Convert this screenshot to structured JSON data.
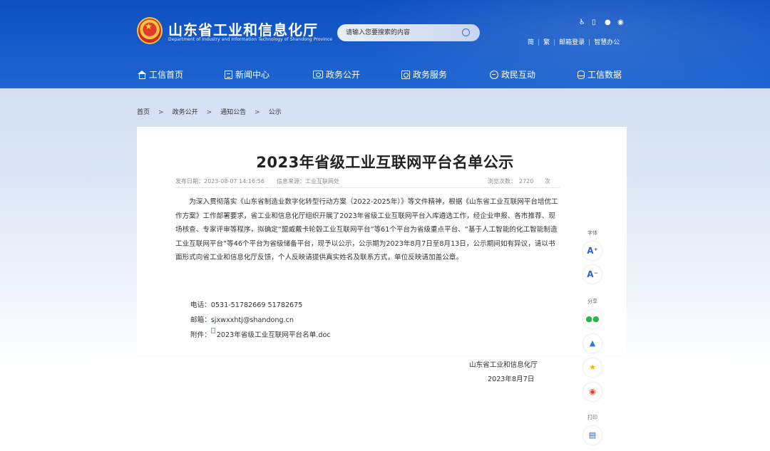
{
  "header": {
    "site_name": "山东省工业和信息化厅",
    "site_name_en": "Department of Industry and Information Technology of Shandong Province",
    "search_placeholder": "请输入您要搜索的内容",
    "util_icons": [
      "accessibility-icon",
      "mobile-icon",
      "wechat-icon",
      "weibo-icon"
    ],
    "util_links": [
      "简",
      "繁",
      "邮箱登录",
      "智慧办公"
    ]
  },
  "nav": {
    "items": [
      {
        "label": "工信首页",
        "icon": "home-icon"
      },
      {
        "label": "新闻中心",
        "icon": "news-icon"
      },
      {
        "label": "政务公开",
        "icon": "screen-icon"
      },
      {
        "label": "政务服务",
        "icon": "service-icon"
      },
      {
        "label": "政民互动",
        "icon": "chat-icon"
      },
      {
        "label": "工信数据",
        "icon": "database-icon"
      }
    ]
  },
  "breadcrumb": {
    "items": [
      "首页",
      "政务公开",
      "通知公告",
      "公示"
    ],
    "separator": ">"
  },
  "article": {
    "title": "2023年省级工业互联网平台名单公示",
    "meta": {
      "date_label": "发布日期：",
      "date": "2023-08-07 14:16:56",
      "source_label": "信息来源：",
      "source": "工业互联网处",
      "views_label": "浏览次数：",
      "views": "2720",
      "close_label": "次"
    },
    "body": "为深入贯彻落实《山东省制造业数字化转型行动方案（2022-2025年）》等文件精神，根据《山东省工业互联网平台培优工作方案》工作部署要求，省工业和信息化厅组织开展了2023年省级工业互联网平台入库遴选工作，经企业申报、各市推荐、现场核查、专家评审等程序，拟确定“盟威戴卡轮毂工业互联网平台”等61个平台为省级重点平台、“基于人工智能的化工智能制造工业互联网平台”等46个平台为省级储备平台，现予以公示，公示期为2023年8月7日至8月13日，公示期间如有异议，请以书面形式向省工业和信息化厅反馈，个人反映请提供真实姓名及联系方式，单位反映请加盖公章。",
    "phone_label": "电话：",
    "phone": "0531-51782669 51782675",
    "email_label": "邮箱：",
    "email": "sjxwxxhtj@shandong.cn",
    "attachment_label": "附件：",
    "attachment": "2023年省级工业互联网平台名单.doc",
    "signature_org": "山东省工业和信息化厅",
    "signature_date": "2023年8月7日"
  },
  "side_tools": {
    "font_label": "字体",
    "font_plus": "A⁺",
    "font_minus": "A⁻",
    "share_label": "分享",
    "print_label": "打印"
  }
}
